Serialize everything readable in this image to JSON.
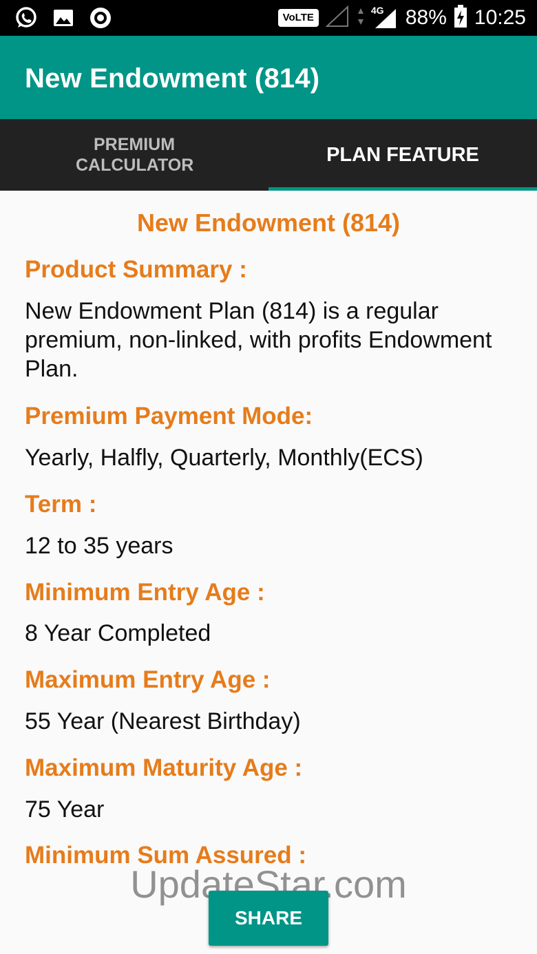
{
  "status_bar": {
    "network_badge": "VoLTE",
    "network_type": "4G",
    "battery": "88%",
    "time": "10:25"
  },
  "app_bar": {
    "title": "New Endowment (814)"
  },
  "tabs": [
    {
      "label": "PREMIUM CALCULATOR",
      "selected": false
    },
    {
      "label": "PLAN FEATURE",
      "selected": true
    }
  ],
  "plan": {
    "heading": "New Endowment (814)",
    "sections": [
      {
        "label": "Product Summary :",
        "value": "New Endowment Plan (814) is a regular premium, non-linked, with profits Endowment Plan."
      },
      {
        "label": "Premium Payment Mode:",
        "value": "Yearly, Halfly, Quarterly, Monthly(ECS)"
      },
      {
        "label": "Term :",
        "value": "12 to 35 years"
      },
      {
        "label": "Minimum Entry Age :",
        "value": "8 Year Completed"
      },
      {
        "label": "Maximum Entry Age :",
        "value": "55 Year (Nearest Birthday)"
      },
      {
        "label": "Maximum Maturity Age :",
        "value": "75 Year"
      },
      {
        "label": "Minimum Sum Assured :"
      }
    ]
  },
  "share_label": "SHARE",
  "watermark": "UpdateStar.com",
  "colors": {
    "primary": "#009587",
    "accent": "#e67c1b",
    "tab_bg": "#222222"
  }
}
